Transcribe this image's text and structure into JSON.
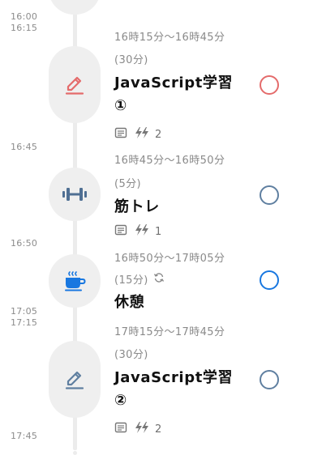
{
  "time_labels": [
    "16:00",
    "16:15",
    "16:45",
    "16:50",
    "17:05",
    "17:15",
    "17:45"
  ],
  "tasks": [
    {
      "time_range": "16時15分〜16時45分",
      "duration": "(30分)",
      "title_line1": "JavaScript学習",
      "title_line2": "①",
      "icon": "pencil-icon",
      "count": "2",
      "status_color": "#e46b6b"
    },
    {
      "time_range": "16時45分〜16時50分",
      "duration": "(5分)",
      "title_line1": "筋トレ",
      "icon": "dumbbell-icon",
      "count": "1",
      "status_color": "#5f7fa0"
    },
    {
      "time_range": "16時50分〜17時05分",
      "duration": "(15分)",
      "title_line1": "休憩",
      "icon": "coffee-icon",
      "repeat_icon": "repeat-icon",
      "status_color": "#1877e0"
    },
    {
      "time_range": "17時15分〜17時45分",
      "duration": "(30分)",
      "title_line1": "JavaScript学習",
      "title_line2": "②",
      "icon": "pencil-icon",
      "count": "2",
      "status_color": "#5f7fa0"
    }
  ],
  "colors": {
    "pencil_red": "#e46b6b",
    "dumbbell_blue": "#4f6f93",
    "coffee_blue": "#1877e0",
    "pencil_blue": "#5f7fa0"
  }
}
